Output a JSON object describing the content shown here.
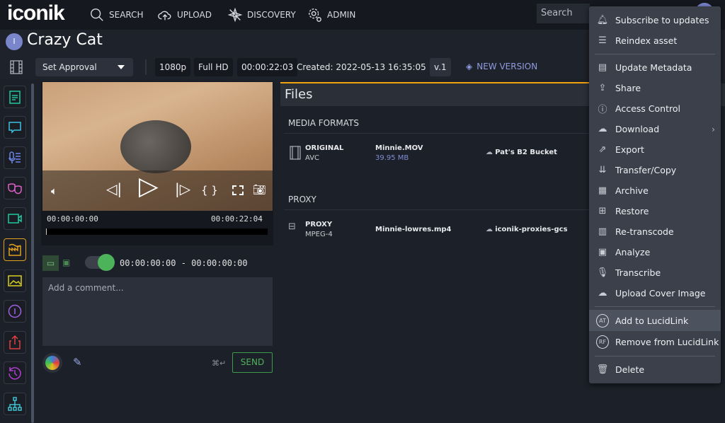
{
  "topbar": {
    "logo": "iconik",
    "nav": [
      {
        "label": "SEARCH",
        "icon": "search-icon"
      },
      {
        "label": "UPLOAD",
        "icon": "cloud-upload-icon"
      },
      {
        "label": "DISCOVERY",
        "icon": "discovery-icon"
      },
      {
        "label": "ADMIN",
        "icon": "gear-icon"
      }
    ],
    "search_placeholder": "Search"
  },
  "asset": {
    "avatar_letter": "I",
    "title": "Crazy Cat"
  },
  "toolbar": {
    "approval": "Set Approval",
    "resolution": "1080p",
    "quality": "Full HD",
    "duration": "00:00:22:03",
    "created": "Created: 2022-05-13 16:35:05",
    "version": "v.1",
    "new_version": "NEW VERSION"
  },
  "player": {
    "time_start": "00:00:00:00",
    "time_end": "00:00:22:04",
    "range": "00:00:00:00 - 00:00:00:00",
    "progress": 0
  },
  "comment": {
    "placeholder": "Add a comment...",
    "shortcut": "⌘↵",
    "send": "SEND"
  },
  "files": {
    "title": "Files",
    "sections": [
      {
        "name": "MEDIA FORMATS",
        "rows": [
          {
            "type": "ORIGINAL",
            "codec": "AVC",
            "filename": "Minnie.MOV",
            "size": "39.95 MB",
            "storage": "Pat's B2 Bucket"
          }
        ]
      },
      {
        "name": "PROXY",
        "rows": [
          {
            "type": "PROXY",
            "codec": "MPEG-4",
            "filename": "Minnie-lowres.mp4",
            "storage": "iconik-proxies-gcs"
          }
        ]
      }
    ]
  },
  "menu": {
    "items": [
      {
        "label": "Subscribe to updates",
        "icon": "bell-icon"
      },
      {
        "label": "Reindex asset",
        "icon": "list-icon"
      },
      {
        "label": "Update Metadata",
        "icon": "metadata-icon"
      },
      {
        "label": "Share",
        "icon": "share-icon"
      },
      {
        "label": "Access Control",
        "icon": "lock-icon"
      },
      {
        "label": "Download",
        "icon": "cloud-download-icon"
      },
      {
        "label": "Export",
        "icon": "export-icon"
      },
      {
        "label": "Transfer/Copy",
        "icon": "transfer-icon"
      },
      {
        "label": "Archive",
        "icon": "archive-icon"
      },
      {
        "label": "Restore",
        "icon": "restore-icon"
      },
      {
        "label": "Re-transcode",
        "icon": "transcode-icon"
      },
      {
        "label": "Analyze",
        "icon": "analyze-icon"
      },
      {
        "label": "Transcribe",
        "icon": "transcribe-icon"
      },
      {
        "label": "Upload Cover Image",
        "icon": "upload-icon"
      },
      {
        "label": "Add to LucidLink",
        "badge": "AT"
      },
      {
        "label": "Remove from LucidLink",
        "badge": "RF"
      },
      {
        "label": "Delete",
        "icon": "trash-icon"
      }
    ]
  },
  "colors": {
    "accent": "#f2a20d",
    "send": "#4fb35c",
    "size": "#7f8ed6"
  }
}
